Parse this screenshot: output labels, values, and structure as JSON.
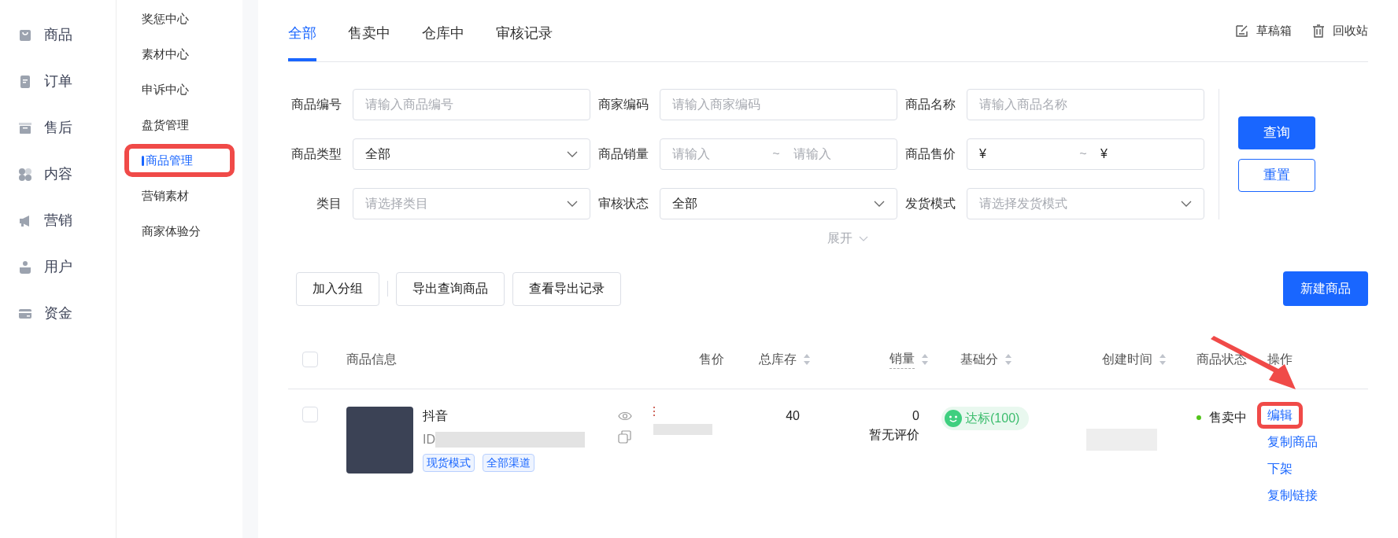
{
  "main_nav": [
    {
      "label": "商品"
    },
    {
      "label": "订单"
    },
    {
      "label": "售后"
    },
    {
      "label": "内容"
    },
    {
      "label": "营销"
    },
    {
      "label": "用户"
    },
    {
      "label": "资金"
    }
  ],
  "sub_nav": [
    {
      "label": "奖惩中心",
      "selected": false,
      "highlighted": false
    },
    {
      "label": "素材中心",
      "selected": false,
      "highlighted": false
    },
    {
      "label": "申诉中心",
      "selected": false,
      "highlighted": false
    },
    {
      "label": "盘货管理",
      "selected": false,
      "highlighted": false
    },
    {
      "label": "商品管理",
      "selected": true,
      "highlighted": true
    },
    {
      "label": "营销素材",
      "selected": false,
      "highlighted": false
    },
    {
      "label": "商家体验分",
      "selected": false,
      "highlighted": false
    }
  ],
  "tabs": [
    {
      "label": "全部",
      "selected": true
    },
    {
      "label": "售卖中",
      "selected": false
    },
    {
      "label": "仓库中",
      "selected": false
    },
    {
      "label": "审核记录",
      "selected": false
    }
  ],
  "top_links": [
    {
      "label": "草稿箱"
    },
    {
      "label": "回收站"
    }
  ],
  "filters": [
    {
      "label": "商品编号",
      "kind": "text",
      "placeholder": "请输入商品编号"
    },
    {
      "label": "商家编码",
      "kind": "text",
      "placeholder": "请输入商家编码"
    },
    {
      "label": "商品名称",
      "kind": "text",
      "placeholder": "请输入商品名称"
    },
    {
      "label": "商品类型",
      "kind": "select",
      "value": "全部"
    },
    {
      "label": "商品销量",
      "kind": "range",
      "from_placeholder": "请输入",
      "separator": "~",
      "to_placeholder": "请输入"
    },
    {
      "label": "商品售价",
      "kind": "range",
      "from_prefix": "¥",
      "separator": "~",
      "to_prefix": "¥"
    },
    {
      "label": "类目",
      "kind": "select",
      "placeholder": "请选择类目"
    },
    {
      "label": "审核状态",
      "kind": "select",
      "value": "全部"
    },
    {
      "label": "发货模式",
      "kind": "select",
      "placeholder": "请选择发货模式"
    }
  ],
  "filter_buttons": {
    "query": "查询",
    "reset": "重置"
  },
  "expand": "展开",
  "toolbar": {
    "left": [
      "加入分组",
      "导出查询商品",
      "查看导出记录"
    ],
    "create": "新建商品"
  },
  "table": {
    "select_all_checked": false,
    "columns": [
      {
        "label": "商品信息",
        "sortable": false
      },
      {
        "label": "售价",
        "sortable": false
      },
      {
        "label": "总库存",
        "sortable": true
      },
      {
        "label": "销量",
        "sortable": true
      },
      {
        "label": "基础分",
        "sortable": true
      },
      {
        "label": "创建时间",
        "sortable": true
      },
      {
        "label": "商品状态",
        "sortable": false
      },
      {
        "label": "操作",
        "sortable": false
      }
    ],
    "rows": [
      {
        "checked": false,
        "name": "抖音",
        "id_label": "ID",
        "tags": [
          "现货模式",
          "全部渠道"
        ],
        "stock": "40",
        "sales": "0",
        "rating": "暂无评价",
        "score": "达标(100)",
        "status": "售卖中",
        "color": "#52c41a",
        "actions": [
          {
            "label": "编辑",
            "highlighted": true
          },
          {
            "label": "复制商品",
            "highlighted": false
          },
          {
            "label": "下架",
            "highlighted": false
          },
          {
            "label": "复制链接",
            "highlighted": false
          }
        ]
      }
    ]
  }
}
